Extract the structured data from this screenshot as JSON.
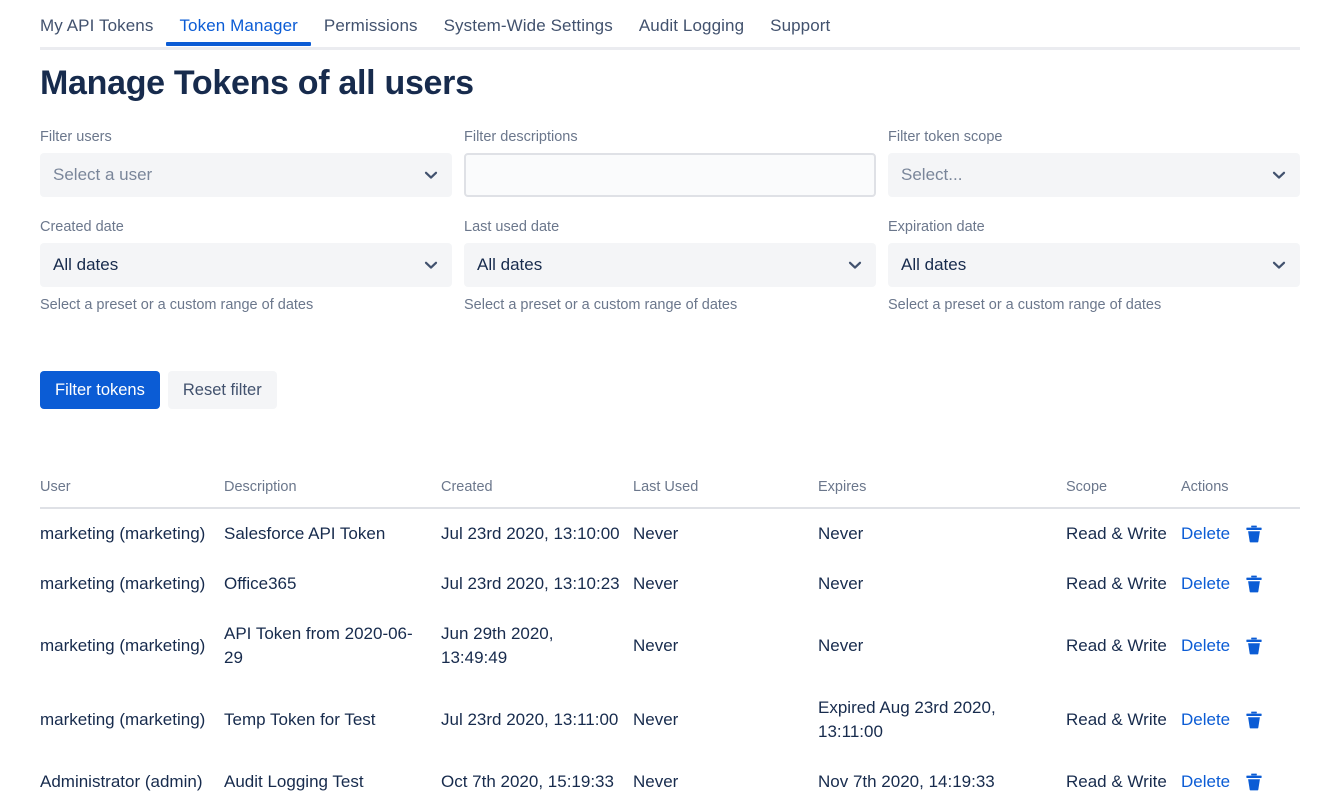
{
  "nav": {
    "items": [
      {
        "label": "My API Tokens",
        "active": false
      },
      {
        "label": "Token Manager",
        "active": true
      },
      {
        "label": "Permissions",
        "active": false
      },
      {
        "label": "System-Wide Settings",
        "active": false
      },
      {
        "label": "Audit Logging",
        "active": false
      },
      {
        "label": "Support",
        "active": false
      }
    ]
  },
  "page": {
    "title": "Manage Tokens of all users"
  },
  "filters": {
    "users": {
      "label": "Filter users",
      "value": "Select a user",
      "is_placeholder": true
    },
    "descriptions": {
      "label": "Filter descriptions",
      "value": "",
      "placeholder": ""
    },
    "token_scope": {
      "label": "Filter token scope",
      "value": "Select...",
      "is_placeholder": true
    },
    "created_date": {
      "label": "Created date",
      "value": "All dates",
      "helper": "Select a preset or a custom range of dates"
    },
    "last_used_date": {
      "label": "Last used date",
      "value": "All dates",
      "helper": "Select a preset or a custom range of dates"
    },
    "expiration_date": {
      "label": "Expiration date",
      "value": "All dates",
      "helper": "Select a preset or a custom range of dates"
    }
  },
  "buttons": {
    "filter_tokens": "Filter tokens",
    "reset_filter": "Reset filter"
  },
  "table": {
    "headers": {
      "user": "User",
      "description": "Description",
      "created": "Created",
      "last_used": "Last Used",
      "expires": "Expires",
      "scope": "Scope",
      "actions": "Actions"
    },
    "rows": [
      {
        "user": "marketing (marketing)",
        "description": "Salesforce API Token",
        "created": "Jul 23rd 2020, 13:10:00",
        "last_used": "Never",
        "expires": "Never",
        "expired": false,
        "scope": "Read & Write",
        "action_label": "Delete"
      },
      {
        "user": "marketing (marketing)",
        "description": "Office365",
        "created": "Jul 23rd 2020, 13:10:23",
        "last_used": "Never",
        "expires": "Never",
        "expired": false,
        "scope": "Read & Write",
        "action_label": "Delete"
      },
      {
        "user": "marketing (marketing)",
        "description": "API Token from 2020-06-29",
        "created": "Jun 29th 2020, 13:49:49",
        "last_used": "Never",
        "expires": "Never",
        "expired": false,
        "scope": "Read & Write",
        "action_label": "Delete"
      },
      {
        "user": "marketing (marketing)",
        "description": "Temp Token for Test",
        "created": "Jul 23rd 2020, 13:11:00",
        "last_used": "Never",
        "expires": "Expired Aug 23rd 2020, 13:11:00",
        "expired": true,
        "scope": "Read & Write",
        "action_label": "Delete"
      },
      {
        "user": "Administrator (admin)",
        "description": "Audit Logging Test",
        "created": "Oct 7th 2020, 15:19:33",
        "last_used": "Never",
        "expires": "Nov 7th 2020, 14:19:33",
        "expired": false,
        "scope": "Read & Write",
        "action_label": "Delete"
      }
    ]
  },
  "colors": {
    "accent_blue": "#0B5CD5",
    "text_dark": "#172B4D",
    "text_muted": "#6B778C",
    "control_bg": "#F4F5F7",
    "expired_red": "#FF0000"
  }
}
